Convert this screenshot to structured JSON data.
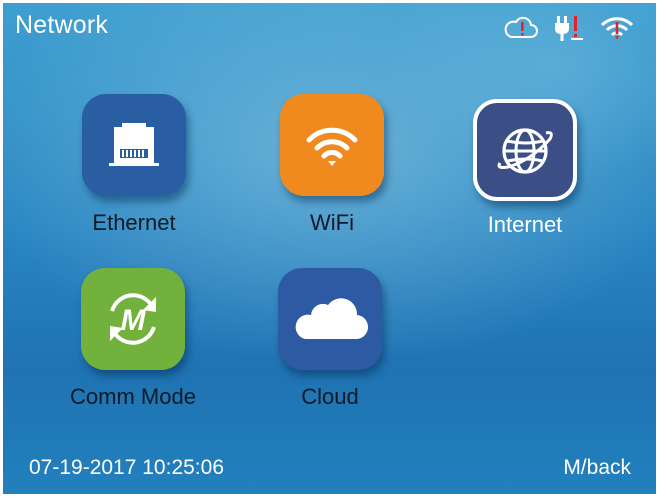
{
  "header": {
    "title": "Network",
    "status_icons": [
      "cloud-alert-icon",
      "ethernet-alert-icon",
      "wifi-alert-icon"
    ]
  },
  "apps": [
    {
      "label": "Ethernet",
      "icon": "ethernet-port-icon",
      "color": "#2a5ea3",
      "selected": false
    },
    {
      "label": "WiFi",
      "icon": "wifi-icon",
      "color": "#f08a1e",
      "selected": false
    },
    {
      "label": "Internet",
      "icon": "globe-icon",
      "color": "#3b4e86",
      "selected": true
    },
    {
      "label": "Comm Mode",
      "icon": "comm-mode-icon",
      "color": "#72b23c",
      "selected": false
    },
    {
      "label": "Cloud",
      "icon": "cloud-icon",
      "color": "#2d5aa3",
      "selected": false
    }
  ],
  "footer": {
    "datetime": "07-19-2017 10:25:06",
    "back_label": "M/back"
  },
  "colors": {
    "alert": "#e3232a",
    "text_dark": "#0e1a26",
    "text_light": "#ffffff"
  }
}
